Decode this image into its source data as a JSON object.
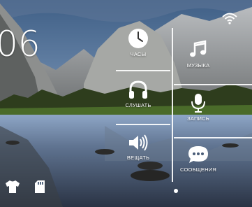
{
  "clock": {
    "time_partial": "06",
    "line2": "",
    "line3": ""
  },
  "tiles": {
    "clock": {
      "label": "ЧАСЫ",
      "icon": "clock-icon"
    },
    "listen": {
      "label": "СЛУШАТЬ",
      "icon": "headphones-icon"
    },
    "speak": {
      "label": "ВЕЩАТЬ",
      "icon": "speaker-icon"
    },
    "music": {
      "label": "МУЗЫКА",
      "icon": "music-note-icon"
    },
    "record": {
      "label": "ЗАПИСЬ",
      "icon": "microphone-icon"
    },
    "messages": {
      "label": "СООБЩЕНИЯ",
      "icon": "chat-bubble-icon"
    }
  },
  "status": {
    "wifi_icon": "wifi-icon",
    "shirt_icon": "tshirt-icon",
    "sd_icon": "sd-card-icon"
  },
  "pager": {
    "active_index": 0
  }
}
